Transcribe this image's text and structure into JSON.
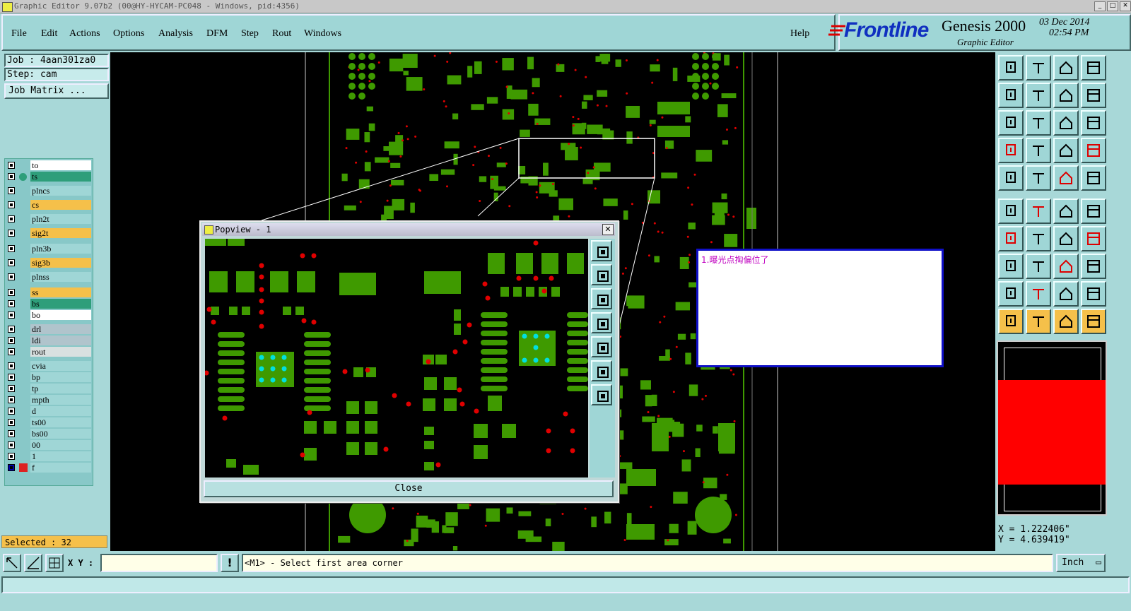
{
  "window": {
    "title": "Graphic Editor 9.07b2 (00@HY-HYCAM-PC048 - Windows, pid:4356)"
  },
  "menu": [
    "File",
    "Edit",
    "Actions",
    "Options",
    "Analysis",
    "DFM",
    "Step",
    "Rout",
    "Windows"
  ],
  "help_label": "Help",
  "brand": {
    "logo": "Frontline",
    "product": "Genesis 2000",
    "subtitle": "Graphic Editor",
    "date": "03 Dec 2014",
    "time": "02:54 PM"
  },
  "job": {
    "job_text": "Job : 4aan301za0",
    "step_text": "Step: cam",
    "matrix_label": "Job Matrix ..."
  },
  "layers": [
    {
      "name": "to",
      "color": "#ffffff"
    },
    {
      "name": "ts",
      "color": "#2e9e7a"
    },
    {
      "name": "plncs",
      "color": "#9fd6d6"
    },
    {
      "name": "cs",
      "color": "#f5c04a"
    },
    {
      "name": "pln2t",
      "color": "#9fd6d6"
    },
    {
      "name": "sig2t",
      "color": "#f5c04a"
    },
    {
      "name": "pln3b",
      "color": "#9fd6d6"
    },
    {
      "name": "sig3b",
      "color": "#f5c04a"
    },
    {
      "name": "plnss",
      "color": "#9fd6d6"
    },
    {
      "name": "ss",
      "color": "#f5c04a"
    },
    {
      "name": "bs",
      "color": "#2e9e7a"
    },
    {
      "name": "bo",
      "color": "#ffffff"
    },
    {
      "name": "drl",
      "color": "#b0c4cc"
    },
    {
      "name": "ldi",
      "color": "#b0c4cc"
    },
    {
      "name": "rout",
      "color": "#d8e0e0"
    },
    {
      "name": "cvia",
      "color": "#9fd6d6"
    },
    {
      "name": "bp",
      "color": "#9fd6d6"
    },
    {
      "name": "tp",
      "color": "#9fd6d6"
    },
    {
      "name": "mpth",
      "color": "#9fd6d6"
    },
    {
      "name": "d",
      "color": "#9fd6d6"
    },
    {
      "name": "ts00",
      "color": "#9fd6d6"
    },
    {
      "name": "bs00",
      "color": "#9fd6d6"
    },
    {
      "name": "00",
      "color": "#9fd6d6"
    },
    {
      "name": "1",
      "color": "#9fd6d6"
    },
    {
      "name": "f",
      "color": "#9fd6d6"
    }
  ],
  "selected_text": "Selected : 32",
  "popview": {
    "title": "Popview - 1",
    "close_label": "Close"
  },
  "note": {
    "text": "1.曝光点掏偏位了"
  },
  "coords": {
    "x_text": "X = 1.222406\"",
    "y_text": "Y = 4.639419\""
  },
  "status": {
    "xy_label": "X Y :",
    "xy_value": "",
    "prompt": "<M1> - Select first area corner",
    "units": "Inch"
  },
  "colors": {
    "pad": "#3f9a00",
    "drill": "#e00000",
    "bg": "#000000",
    "panel": "#a8d8d8",
    "via": "#00e0e0"
  }
}
